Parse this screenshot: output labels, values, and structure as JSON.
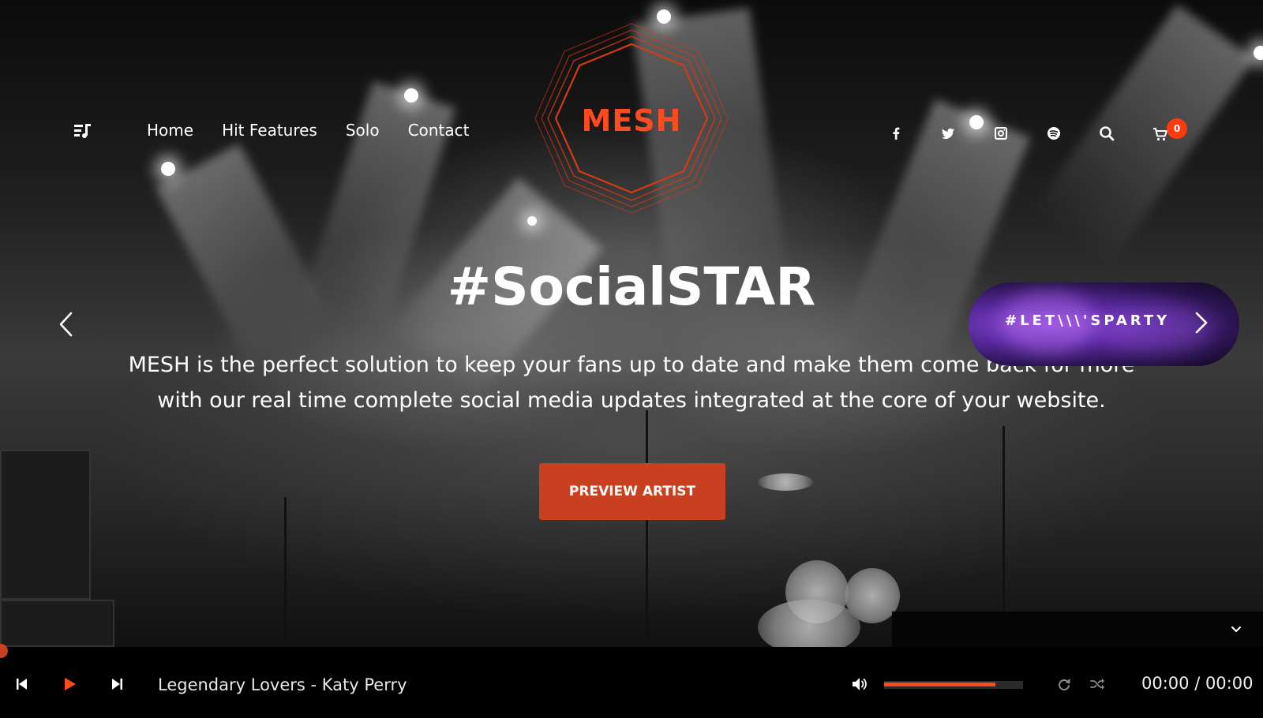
{
  "brand": {
    "logo_text": "MESH",
    "accent_color": "#ff4b1f"
  },
  "nav": {
    "items": [
      {
        "label": "Home"
      },
      {
        "label": "Hit Features"
      },
      {
        "label": "Solo"
      },
      {
        "label": "Contact"
      }
    ]
  },
  "header_icons": [
    "playlist-icon",
    "facebook-icon",
    "twitter-icon",
    "instagram-icon",
    "spotify-icon",
    "search-icon",
    "cart-icon"
  ],
  "cart": {
    "count": "0"
  },
  "hero": {
    "headline": "#SocialSTAR",
    "subline_1": "MESH is the perfect solution to keep your fans up to date and make them come back for more",
    "subline_2": "with our real time complete social media updates integrated at the core of your website.",
    "cta_label": "PREVIEW ARTIST",
    "next_slide_label": "#LET\\\\\\'SPARTY"
  },
  "player": {
    "track_title": "Legendary Lovers - Katy Perry",
    "time_display": "00:00 / 00:00",
    "volume_level": 0.8
  }
}
